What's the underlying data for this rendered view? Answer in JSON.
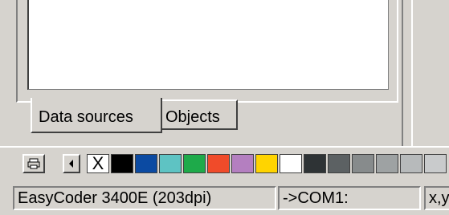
{
  "tabs": [
    {
      "label": "Data sources",
      "active": true
    },
    {
      "label": "Objects",
      "active": false
    }
  ],
  "toolbar": {
    "printer_icon": "printer-icon",
    "arrow_icon": "left-arrow-icon",
    "palette": [
      {
        "name": "no-color",
        "color": "#ffffff",
        "glyph": "X"
      },
      {
        "name": "black",
        "color": "#000000"
      },
      {
        "name": "blue",
        "color": "#0b4aa2"
      },
      {
        "name": "cyan",
        "color": "#5ec3c3"
      },
      {
        "name": "green",
        "color": "#1eaa4a"
      },
      {
        "name": "red",
        "color": "#f04b2a"
      },
      {
        "name": "purple",
        "color": "#b47fc0"
      },
      {
        "name": "yellow",
        "color": "#ffd400"
      },
      {
        "name": "white",
        "color": "#ffffff"
      },
      {
        "name": "dark-gray",
        "color": "#2e3335"
      },
      {
        "name": "gray-1",
        "color": "#5c6163"
      },
      {
        "name": "gray-2",
        "color": "#878b8c"
      },
      {
        "name": "gray-3",
        "color": "#9ea2a3"
      },
      {
        "name": "gray-4",
        "color": "#b7babb"
      },
      {
        "name": "gray-5",
        "color": "#c9cbcc"
      }
    ]
  },
  "status": {
    "printer": "EasyCoder 3400E (203dpi)",
    "port": "->COM1:",
    "coords": "x,y"
  }
}
